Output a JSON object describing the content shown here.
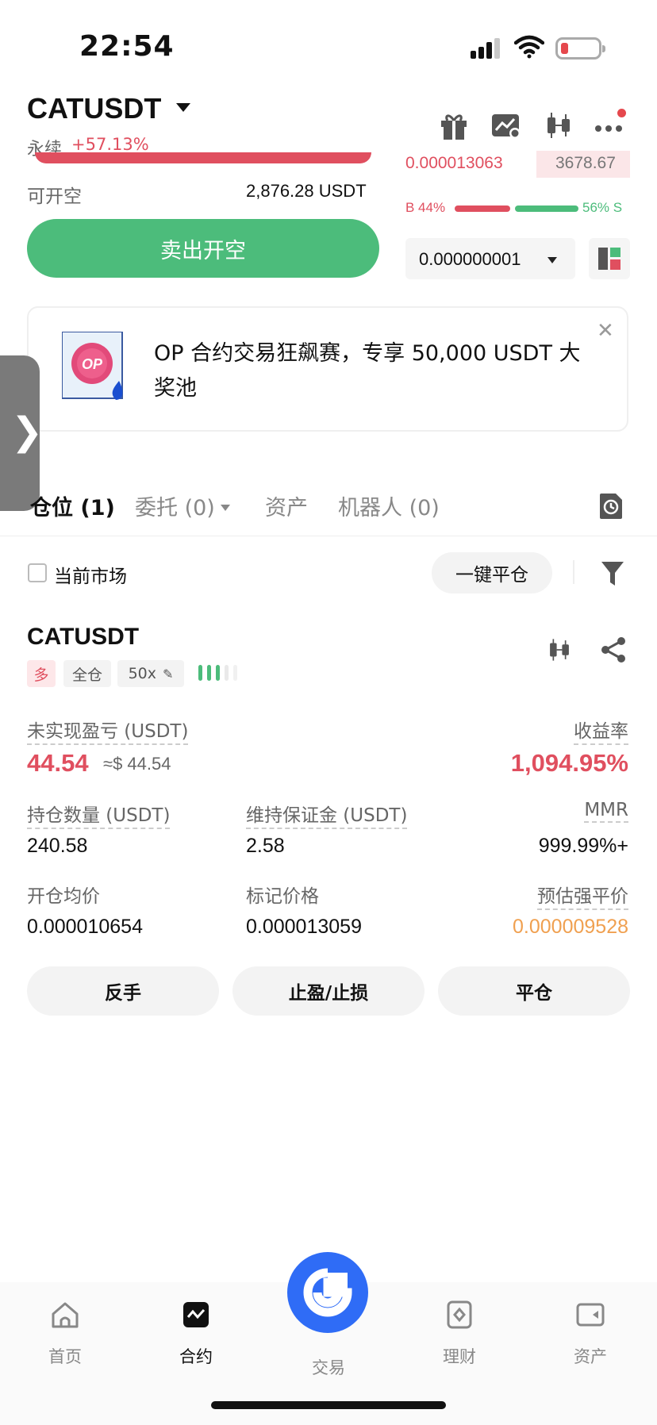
{
  "status_bar": {
    "time": "22:54"
  },
  "header": {
    "pair": "CATUSDT",
    "contract_type": "永续",
    "change_pct": "+57.13%"
  },
  "order_form": {
    "available_label": "可开空",
    "available_value": "2,876.28 USDT",
    "sell_button": "卖出开空"
  },
  "order_book": {
    "ask_price": "0.000013063",
    "ask_qty": "3678.67",
    "buy_ratio": "B 44%",
    "sell_ratio": "56% S",
    "buy_ratio_value": 0.44,
    "depth_value": "0.000000001"
  },
  "banner": {
    "logo_text": "OP",
    "text": "OP 合约交易狂飙赛，专享 50,000 USDT 大奖池"
  },
  "tabs": [
    {
      "label": "仓位 (1)"
    },
    {
      "label": "委托 (0)"
    },
    {
      "label": "资产"
    },
    {
      "label": "机器人 (0)"
    }
  ],
  "filter_bar": {
    "current_market_label": "当前市场",
    "close_all_button": "一键平仓"
  },
  "position": {
    "pair": "CATUSDT",
    "side_tag": "多",
    "margin_tag": "全仓",
    "leverage_tag": "50x",
    "unrealized_pnl_label": "未实现盈亏 (USDT)",
    "unrealized_pnl": "44.54",
    "unrealized_pnl_usd": "≈$ 44.54",
    "roe_label": "收益率",
    "roe": "1,094.95%",
    "size_label": "持仓数量 (USDT)",
    "size": "240.58",
    "margin_label": "维持保证金 (USDT)",
    "margin": "2.58",
    "mmr_label": "MMR",
    "mmr": "999.99%+",
    "entry_label": "开仓均价",
    "entry": "0.000010654",
    "mark_label": "标记价格",
    "mark": "0.000013059",
    "liq_label": "预估强平价",
    "liq": "0.000009528",
    "buttons": {
      "reverse": "反手",
      "tpsl": "止盈/止损",
      "close": "平仓"
    }
  },
  "bottom_nav": [
    {
      "label": "首页"
    },
    {
      "label": "合约"
    },
    {
      "label": "交易"
    },
    {
      "label": "理财"
    },
    {
      "label": "资产"
    }
  ],
  "colors": {
    "red": "#e04f5f",
    "green": "#4cbc7b",
    "blue": "#2f6cf6",
    "orange": "#f0a050"
  }
}
